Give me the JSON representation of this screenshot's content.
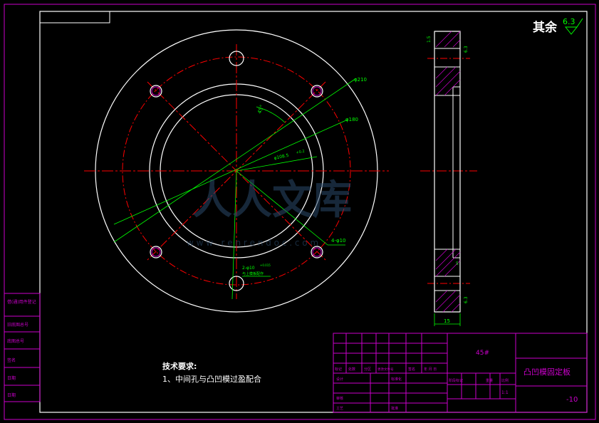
{
  "corner_note": {
    "text": "其余",
    "roughness": "6.3"
  },
  "dimensions": {
    "d_outer": "φ210",
    "d_hole_circle": "φ180",
    "d_bore": "φ108.5",
    "d_bore_tol": "+0.2",
    "angle": "45°",
    "note_4x": "4-φ10",
    "note_2x": "2-φ10",
    "note_2x_tol": "+0.015",
    "note_2x_sub": "与上模板配作",
    "side_thickness": "15",
    "side_chamfer_top": "1.5",
    "side_roughness_top": "6.3",
    "side_roughness_bottom": "6.3",
    "side_small": "5"
  },
  "tech_req": {
    "title": "技术要求:",
    "item1": "1、中间孔与凸凹模过盈配合"
  },
  "title_block": {
    "material": "45#",
    "part_name": "凸凹模固定板",
    "scale": "1:1",
    "drawing_no": "-10",
    "cells": [
      "标记",
      "处数",
      "分区",
      "更改文件号",
      "签名",
      "年 月 日",
      "设计",
      "标准化",
      "审核",
      "工艺",
      "批准",
      "阶段标记",
      "重量",
      "比例"
    ]
  },
  "left_strip": [
    "借(通)用件登记",
    "旧底图总号",
    "底图总号",
    "签名",
    "日期"
  ],
  "watermark": {
    "text": "人人文库",
    "url": "w w w . r e n r e n d o c . c o m"
  }
}
